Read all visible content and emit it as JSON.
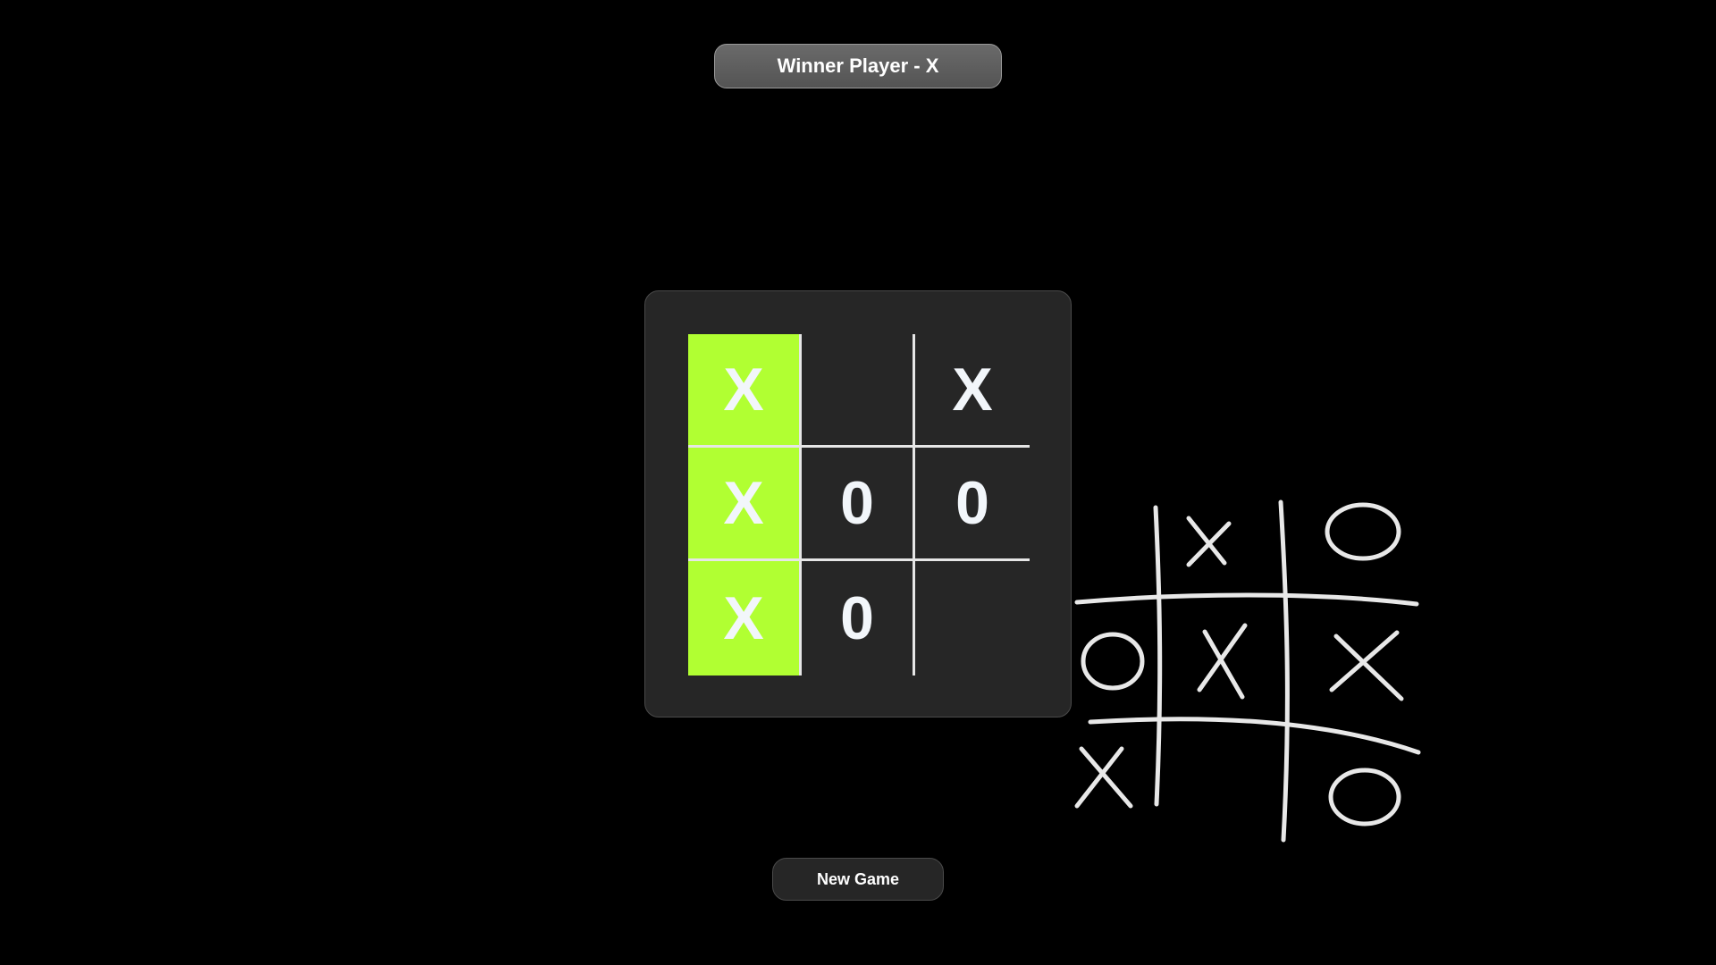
{
  "banner": {
    "text": "Winner Player - X"
  },
  "board": {
    "cells": [
      {
        "mark": "X",
        "win": true
      },
      {
        "mark": "",
        "win": false
      },
      {
        "mark": "X",
        "win": false
      },
      {
        "mark": "X",
        "win": true
      },
      {
        "mark": "0",
        "win": false
      },
      {
        "mark": "0",
        "win": false
      },
      {
        "mark": "X",
        "win": true
      },
      {
        "mark": "0",
        "win": false
      },
      {
        "mark": "",
        "win": false
      }
    ],
    "win_color": "#b1ff32"
  },
  "controls": {
    "new_game_label": "New Game"
  },
  "colors": {
    "background": "#000000",
    "panel": "#262626",
    "banner": "#5e5e5e",
    "text": "#f2f6fa"
  },
  "decoration": {
    "icon": "tic-tac-toe-doodle-icon"
  }
}
